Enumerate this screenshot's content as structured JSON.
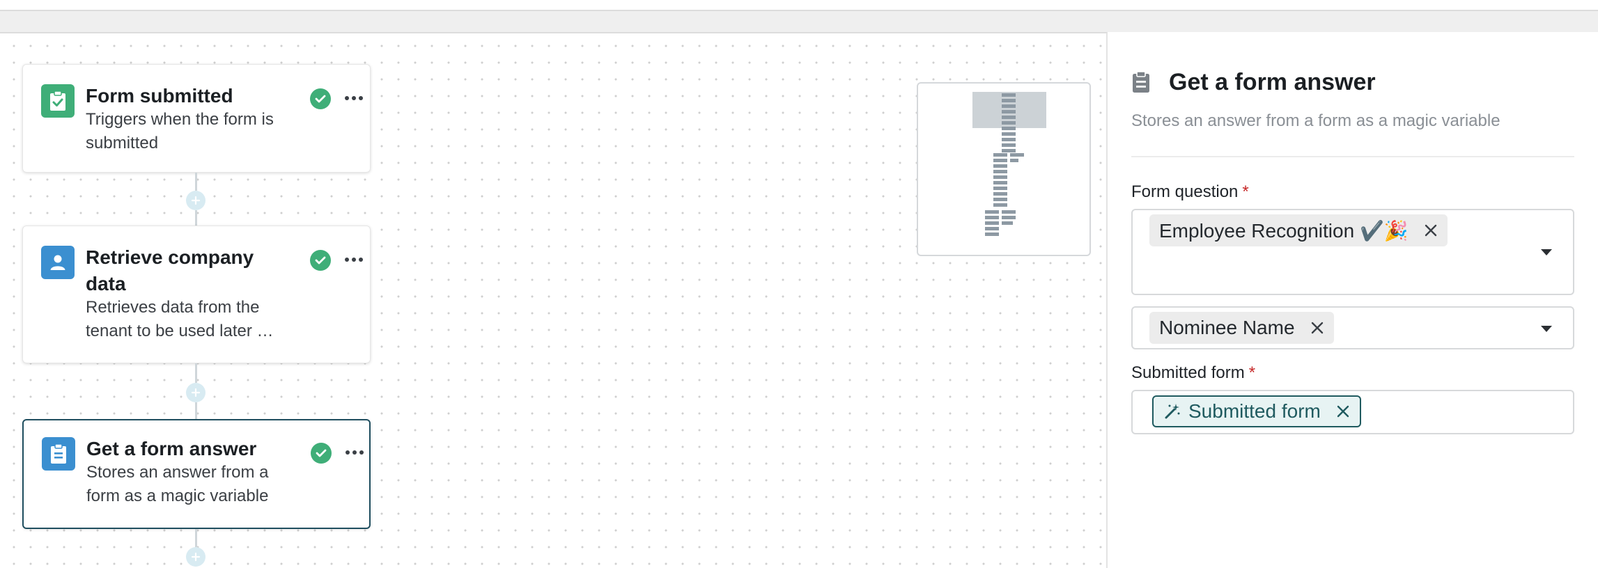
{
  "workflow": {
    "nodes": [
      {
        "title": "Form submitted",
        "description": "Triggers when the form is submitted",
        "icon": "clipboard-check-icon",
        "icon_color": "#3fae78",
        "status": "complete"
      },
      {
        "title": "Retrieve company data",
        "description": "Retrieves data from the tenant to be used later …",
        "icon": "person-icon",
        "icon_color": "#3b8fd0",
        "status": "complete"
      },
      {
        "title": "Get a form answer",
        "description": "Stores an answer from a form as a magic variable",
        "icon": "clipboard-icon",
        "icon_color": "#3b8fd0",
        "status": "complete",
        "selected": true
      }
    ]
  },
  "panel": {
    "title": "Get a form answer",
    "title_icon": "clipboard-icon",
    "subtitle": "Stores an answer from a form as a magic variable",
    "form_question": {
      "label": "Form question",
      "required_mark": "*",
      "selected_form": "Employee Recognition ✔️🎉",
      "selected_question": "Nominee Name"
    },
    "submitted_form": {
      "label": "Submitted form",
      "required_mark": "*",
      "value": "Submitted form",
      "value_icon": "magic-wand-icon"
    }
  },
  "colors": {
    "accent_dark": "#1f4e5f",
    "success": "#3fae78",
    "required": "#c62828"
  }
}
